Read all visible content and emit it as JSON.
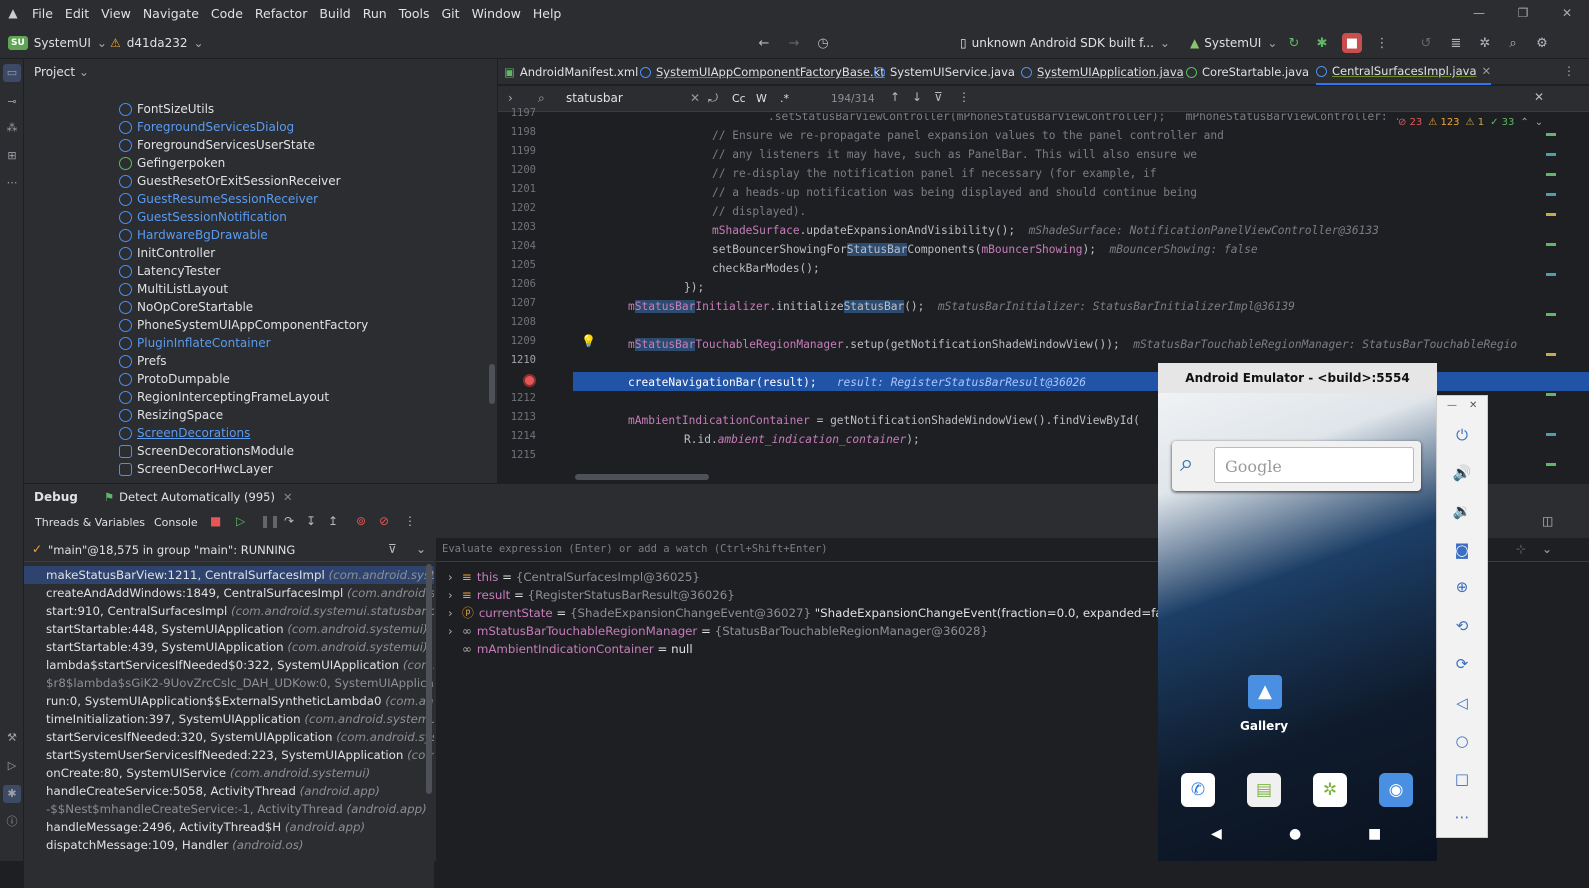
{
  "menu": {
    "items": [
      "File",
      "Edit",
      "View",
      "Navigate",
      "Code",
      "Refactor",
      "Build",
      "Run",
      "Tools",
      "Git",
      "Window",
      "Help"
    ]
  },
  "toolbar": {
    "project_badge": "SU",
    "project": "SystemUI",
    "commit": "d41da232",
    "device": "unknown Android SDK built f...",
    "module": "SystemUI"
  },
  "project_panel": {
    "title": "Project",
    "items": [
      "FontSizeUtils",
      "ForegroundServicesDialog",
      "ForegroundServicesUserState",
      "Gefingerpoken",
      "GuestResetOrExitSessionReceiver",
      "GuestResumeSessionReceiver",
      "GuestSessionNotification",
      "HardwareBgDrawable",
      "InitController",
      "LatencyTester",
      "MultiListLayout",
      "NoOpCoreStartable",
      "PhoneSystemUIAppComponentFactory",
      "PluginInflateContainer",
      "Prefs",
      "ProtoDumpable",
      "RegionInterceptingFrameLayout",
      "ResizingSpace",
      "ScreenDecorations",
      "ScreenDecorationsModule",
      "ScreenDecorHwcLayer"
    ]
  },
  "tabs": [
    "AndroidManifest.xml",
    "SystemUIAppComponentFactoryBase.kt",
    "SystemUIService.java",
    "SystemUIApplication.java",
    "CoreStartable.java",
    "CentralSurfacesImpl.java"
  ],
  "find": {
    "query": "statusbar",
    "case": "Cc",
    "word": "W",
    "regex": ".*",
    "count": "194/314"
  },
  "inspections": {
    "errors": "23",
    "warnings": "123",
    "weak": "1",
    "ok": "33"
  },
  "gutter": {
    "lines": [
      "1197",
      "1198",
      "1199",
      "1200",
      "1201",
      "1202",
      "1203",
      "1204",
      "1205",
      "1206",
      "1207",
      "1208",
      "1209",
      "1210",
      "1211",
      "1212",
      "1213",
      "1214",
      "1215"
    ]
  },
  "code": {
    "l1197": ".setStatusBarViewController(mPhoneStatusBarViewController);   mPhoneStatusBarViewController: ...",
    "l1198": "// Ensure we re-propagate panel expansion values to the panel controller and",
    "l1199": "// any listeners it may have, such as PanelBar. This will also ensure we",
    "l1200": "// re-display the notification panel if necessary (for example, if",
    "l1201": "// a heads-up notification was being displayed and should continue being",
    "l1202": "// displayed).",
    "l1203a": "mShadeSurface",
    ".l1203b": "",
    "l1203": ".updateExpansionAndVisibility();",
    "h1203": "mShadeSurface: NotificationPanelViewController@36133",
    "l1204a": "setBouncerShowingFor",
    "l1204b": "StatusBar",
    "l1204c": "Components(",
    "l1204d": "mBouncerShowing",
    "l1204e": ");",
    "h1204": "mBouncerShowing: false",
    "l1205": "checkBarModes();",
    "l1206": "});",
    "l1207a": "m",
    "l1207b": "StatusBar",
    "l1207c": "Initializer",
    ".": "",
    "l1207d": ".initialize",
    "l1207e": "StatusBar",
    "l1207f": "();",
    "h1207": "mStatusBarInitializer: StatusBarInitializerImpl@36139",
    "l1209a": "m",
    "l1209b": "StatusBar",
    "l1209c": "TouchableRegionManager",
    "l1209d": ".setup(getNotificationShadeWindowView());",
    "h1209": "mStatusBarTouchableRegionManager: StatusBarTouchableRegio",
    "l1211": "createNavigationBar(result);",
    "h1211": "result: RegisterStatusBarResult@36026",
    "l1213a": "mAmbientIndicationContainer",
    "l1213b": " = getNotificationShadeWindowView().findViewById(",
    "l1214a": "R.id.",
    "l1214b": "ambient_indication_container",
    "l1214c": ");"
  },
  "debug": {
    "tab": "Debug",
    "session": "Detect Automatically (995)",
    "sub1": "Threads & Variables",
    "sub2": "Console",
    "thread": "\"main\"@18,575 in group \"main\": RUNNING",
    "eval_placeholder": "Evaluate expression (Enter) or add a watch (Ctrl+Shift+Enter)",
    "frames": [
      {
        "m": "makeStatusBarView:1211, CentralSurfacesImpl",
        "p": "(com.android.systemui.s"
      },
      {
        "m": "createAndAddWindows:1849, CentralSurfacesImpl",
        "p": "(com.android.system"
      },
      {
        "m": "start:910, CentralSurfacesImpl",
        "p": "(com.android.systemui.statusbar.phone)"
      },
      {
        "m": "startStartable:448, SystemUIApplication",
        "p": "(com.android.systemui)"
      },
      {
        "m": "startStartable:439, SystemUIApplication",
        "p": "(com.android.systemui)"
      },
      {
        "m": "lambda$startServicesIfNeeded$0:322, SystemUIApplication",
        "p": "(com.andro"
      },
      {
        "m": "$r8$lambda$sGiK2-9UovZrcCslc_DAH_UDKow:0, SystemUIApplication",
        "p": "("
      },
      {
        "m": "run:0, SystemUIApplication$$ExternalSyntheticLambda0",
        "p": "(com.android.s"
      },
      {
        "m": "timeInitialization:397, SystemUIApplication",
        "p": "(com.android.systemui)"
      },
      {
        "m": "startServicesIfNeeded:320, SystemUIApplication",
        "p": "(com.android.systemu"
      },
      {
        "m": "startSystemUserServicesIfNeeded:223, SystemUIApplication",
        "p": "(com.andr"
      },
      {
        "m": "onCreate:80, SystemUIService",
        "p": "(com.android.systemui)"
      },
      {
        "m": "handleCreateService:5058, ActivityThread",
        "p": "(android.app)"
      },
      {
        "m": "-$$Nest$mhandleCreateService:-1, ActivityThread",
        "p": "(android.app)"
      },
      {
        "m": "handleMessage:2496, ActivityThread$H",
        "p": "(android.app)"
      },
      {
        "m": "dispatchMessage:109, Handler",
        "p": "(android.os)"
      }
    ],
    "vars": [
      {
        "k": "this",
        "eq": " = ",
        "v": "{CentralSurfacesImpl@36025}",
        "w": ""
      },
      {
        "k": "result",
        "eq": " = ",
        "v": "{RegisterStatusBarResult@36026}",
        "w": ""
      },
      {
        "k": "currentState",
        "eq": " = ",
        "v": "{ShadeExpansionChangeEvent@36027}",
        "w": " \"ShadeExpansionChangeEvent(fraction=0.0, expanded=false, trackin"
      },
      {
        "k": "mStatusBarTouchableRegionManager",
        "eq": " = ",
        "v": "{StatusBarTouchableRegionManager@36028}",
        "w": ""
      },
      {
        "k": "mAmbientIndicationContainer",
        "eq": " = ",
        "v": "",
        "w": "null"
      }
    ]
  },
  "emulator": {
    "title": "Android Emulator - <build>:5554",
    "search_placeholder": "Google",
    "app_label": "Gallery"
  },
  "colors": {
    "accent": "#3574f0",
    "exec_line": "#2154a6",
    "breakpoint": "#e55757"
  }
}
